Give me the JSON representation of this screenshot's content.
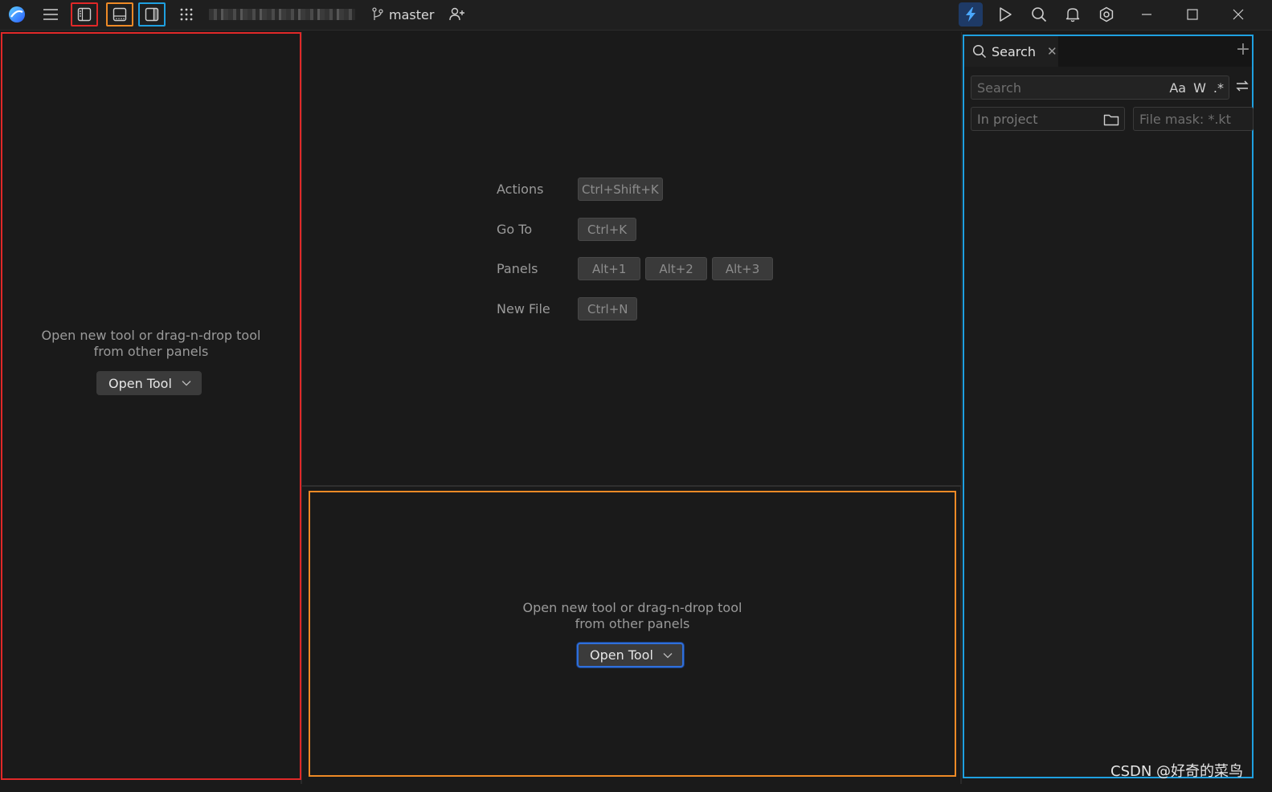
{
  "titlebar": {
    "branch_name": "master",
    "icons": [
      "app-logo",
      "hamburger-menu",
      "toggle-left-panel",
      "toggle-bottom-panel",
      "toggle-right-panel",
      "apps-grid",
      "branch",
      "add-user",
      "ai-bolt",
      "run",
      "search",
      "notifications",
      "settings",
      "minimize",
      "maximize",
      "close"
    ]
  },
  "left_panel": {
    "message_line1": "Open new tool or drag-n-drop tool",
    "message_line2": "from other panels",
    "open_tool_label": "Open Tool"
  },
  "center": {
    "shortcuts": [
      {
        "label": "Actions",
        "keys": [
          "Ctrl+Shift+K"
        ]
      },
      {
        "label": "Go To",
        "keys": [
          "Ctrl+K"
        ]
      },
      {
        "label": "Panels",
        "keys": [
          "Alt+1",
          "Alt+2",
          "Alt+3"
        ]
      },
      {
        "label": "New File",
        "keys": [
          "Ctrl+N"
        ]
      }
    ]
  },
  "bottom_panel": {
    "message_line1": "Open new tool or drag-n-drop tool",
    "message_line2": "from other panels",
    "open_tool_label": "Open Tool"
  },
  "right_panel": {
    "tab_label": "Search",
    "search_placeholder": "Search",
    "match_case": "Aa",
    "whole_word": "W",
    "regex": ".*",
    "scope_label": "In project",
    "file_mask_placeholder": "File mask: *.kt"
  },
  "watermark": "CSDN @好奇的菜鸟",
  "colors": {
    "highlight_left": "#e02828",
    "highlight_bottom": "#ee8a26",
    "highlight_right": "#1fa0e0",
    "accent_blue": "#2f6fdb"
  }
}
